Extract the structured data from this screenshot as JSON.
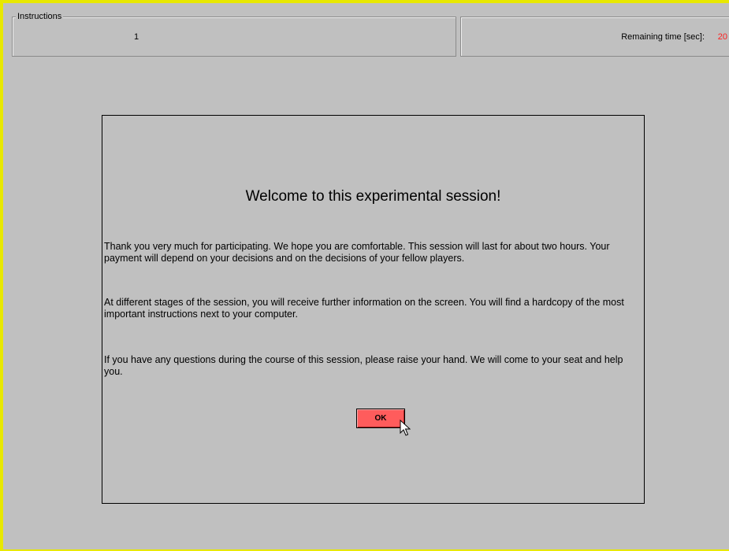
{
  "header": {
    "section_label": "Instructions",
    "period_number": "1",
    "remaining_time_label": "Remaining time [sec]:",
    "remaining_time_value": "20"
  },
  "dialog": {
    "title": "Welcome to this experimental session!",
    "paragraphs": [
      "Thank you very much for participating. We hope you are comfortable. This session will last for about two hours. Your payment will depend on your decisions and on the decisions of your fellow players.",
      "At different stages of the session, you will receive further information on the screen. You will find a hardcopy of the most important instructions next to your computer.",
      "If you have any questions during the course of this session, please raise your hand. We will come to your seat and help you."
    ],
    "ok_label": "OK"
  },
  "colors": {
    "background": "#c0c0c0",
    "window_border": "#e8e800",
    "button": "#ff5c5c",
    "time_value": "#ff2020"
  },
  "icons": {
    "cursor": "mouse-pointer-icon"
  }
}
